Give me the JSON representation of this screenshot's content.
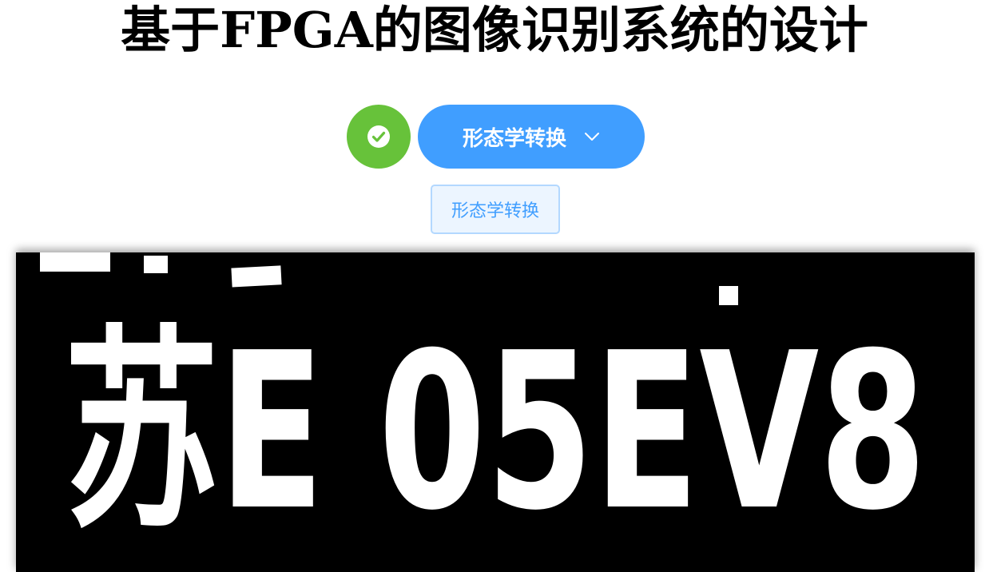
{
  "header": {
    "title": "基于FPGA的图像识别系统的设计"
  },
  "toolbar": {
    "status_icon": "check-circle-icon",
    "mode_dropdown": {
      "selected": "形态学转换",
      "icon": "chevron-down-icon"
    }
  },
  "mode_tag": {
    "label": "形态学转换"
  },
  "result_image": {
    "plate_text": "苏E 05EV8"
  },
  "colors": {
    "success": "#67c23a",
    "primary": "#409eff",
    "tag_background": "#ecf5ff",
    "tag_border": "#b3d8ff",
    "image_background": "#000000",
    "image_foreground": "#ffffff"
  }
}
